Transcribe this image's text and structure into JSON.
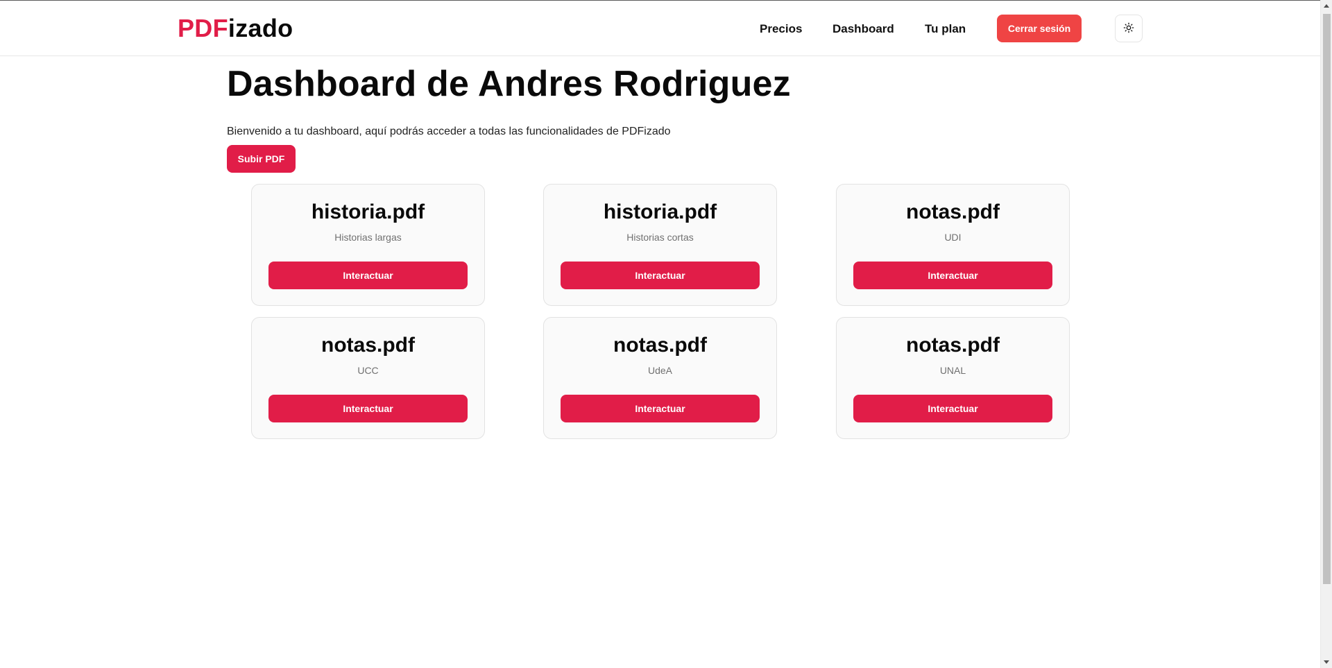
{
  "header": {
    "logo_highlight": "PDF",
    "logo_rest": "izado",
    "nav": {
      "precios": "Precios",
      "dashboard": "Dashboard",
      "plan": "Tu plan"
    },
    "logout_label": "Cerrar sesión",
    "theme_icon": "sun-icon"
  },
  "main": {
    "title": "Dashboard de Andres Rodriguez",
    "welcome": "Bienvenido a tu dashboard, aquí podrás acceder a todas las funcionalidades de PDFizado",
    "upload_label": "Subir PDF",
    "cards": [
      {
        "title": "historia.pdf",
        "subtitle": "Historias largas",
        "button": "Interactuar"
      },
      {
        "title": "historia.pdf",
        "subtitle": "Historias cortas",
        "button": "Interactuar"
      },
      {
        "title": "notas.pdf",
        "subtitle": "UDI",
        "button": "Interactuar"
      },
      {
        "title": "notas.pdf",
        "subtitle": "UCC",
        "button": "Interactuar"
      },
      {
        "title": "notas.pdf",
        "subtitle": "UdeA",
        "button": "Interactuar"
      },
      {
        "title": "notas.pdf",
        "subtitle": "UNAL",
        "button": "Interactuar"
      }
    ]
  },
  "colors": {
    "brand": "#e11d48",
    "logout": "#ef4444",
    "card_bg": "#fafafa"
  }
}
